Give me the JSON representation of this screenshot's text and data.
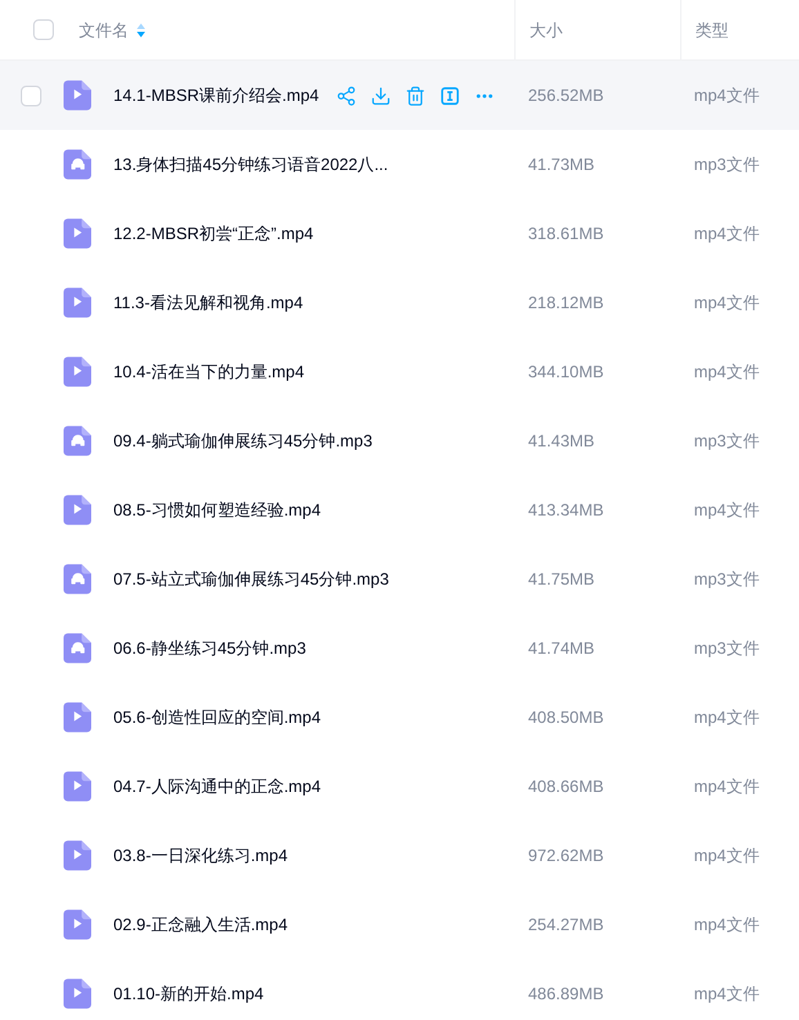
{
  "header": {
    "checked": false,
    "columns": [
      "文件名",
      "大小",
      "类型"
    ]
  },
  "rows": [
    {
      "kind": "video",
      "name": "14.1-MBSR课前介绍会.mp4",
      "size": "256.52MB",
      "type": "mp4文件",
      "hovered": true,
      "checked": false
    },
    {
      "kind": "audio",
      "name": "13.身体扫描45分钟练习语音2022八...",
      "size": "41.73MB",
      "type": "mp3文件",
      "hovered": false,
      "checked": false
    },
    {
      "kind": "video",
      "name": "12.2-MBSR初尝“正念”.mp4",
      "size": "318.61MB",
      "type": "mp4文件",
      "hovered": false,
      "checked": false
    },
    {
      "kind": "video",
      "name": "11.3-看法见解和视角.mp4",
      "size": "218.12MB",
      "type": "mp4文件",
      "hovered": false,
      "checked": false
    },
    {
      "kind": "video",
      "name": "10.4-活在当下的力量.mp4",
      "size": "344.10MB",
      "type": "mp4文件",
      "hovered": false,
      "checked": false
    },
    {
      "kind": "audio",
      "name": "09.4-躺式瑜伽伸展练习45分钟.mp3",
      "size": "41.43MB",
      "type": "mp3文件",
      "hovered": false,
      "checked": false
    },
    {
      "kind": "video",
      "name": "08.5-习惯如何塑造经验.mp4",
      "size": "413.34MB",
      "type": "mp4文件",
      "hovered": false,
      "checked": false
    },
    {
      "kind": "audio",
      "name": "07.5-站立式瑜伽伸展练习45分钟.mp3",
      "size": "41.75MB",
      "type": "mp3文件",
      "hovered": false,
      "checked": false
    },
    {
      "kind": "audio",
      "name": "06.6-静坐练习45分钟.mp3",
      "size": "41.74MB",
      "type": "mp3文件",
      "hovered": false,
      "checked": false
    },
    {
      "kind": "video",
      "name": "05.6-创造性回应的空间.mp4",
      "size": "408.50MB",
      "type": "mp4文件",
      "hovered": false,
      "checked": false
    },
    {
      "kind": "video",
      "name": "04.7-人际沟通中的正念.mp4",
      "size": "408.66MB",
      "type": "mp4文件",
      "hovered": false,
      "checked": false
    },
    {
      "kind": "video",
      "name": "03.8-一日深化练习.mp4",
      "size": "972.62MB",
      "type": "mp4文件",
      "hovered": false,
      "checked": false
    },
    {
      "kind": "video",
      "name": "02.9-正念融入生活.mp4",
      "size": "254.27MB",
      "type": "mp4文件",
      "hovered": false,
      "checked": false
    },
    {
      "kind": "video",
      "name": "01.10-新的开始.mp4",
      "size": "486.89MB",
      "type": "mp4文件",
      "hovered": false,
      "checked": false
    }
  ]
}
